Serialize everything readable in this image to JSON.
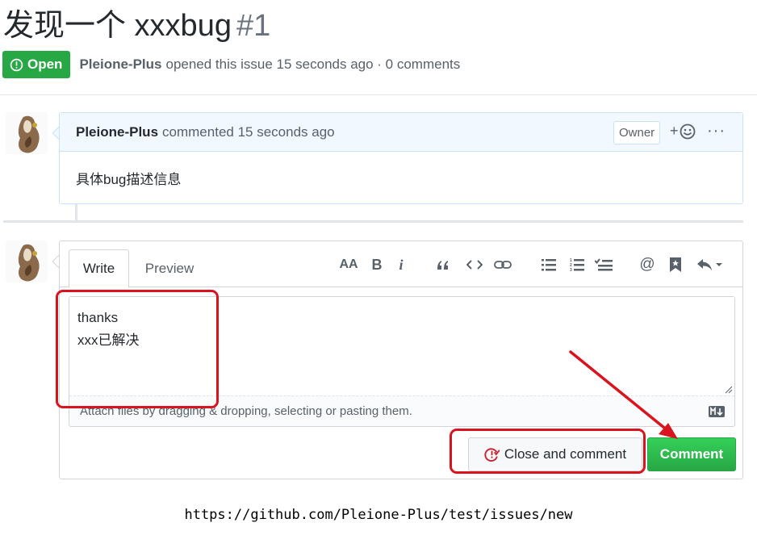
{
  "issue": {
    "title": "发现一个 xxxbug",
    "number": "#1",
    "state": "Open",
    "author": "Pleione-Plus",
    "meta_text": "opened this issue 15 seconds ago · 0 comments"
  },
  "first_comment": {
    "author": "Pleione-Plus",
    "action": "commented 15 seconds ago",
    "badge": "Owner",
    "react_plus": "+",
    "more": "···",
    "body": "具体bug描述信息"
  },
  "new_comment": {
    "tabs": {
      "write": "Write",
      "preview": "Preview"
    },
    "toolbar": [
      "header-icon",
      "bold-icon",
      "italic-icon",
      "quote-icon",
      "code-icon",
      "link-icon",
      "unordered-list-icon",
      "ordered-list-icon",
      "task-list-icon",
      "mention-icon",
      "saved-reply-icon",
      "reply-icon"
    ],
    "toolbar_text": {
      "header": "AA",
      "bold": "B",
      "italic": "i",
      "mention": "@"
    },
    "text_lines": [
      "thanks",
      "xxx已解决"
    ],
    "drag_hint": "Attach files by dragging & dropping, selecting or pasting them.",
    "close_button": "Close and comment",
    "comment_button": "Comment"
  },
  "caption": "https://github.com/Pleione-Plus/test/issues/new",
  "colors": {
    "open_green": "#28a745",
    "annotation_red": "#d9141e",
    "comment_header_bg": "#f1f8ff"
  }
}
